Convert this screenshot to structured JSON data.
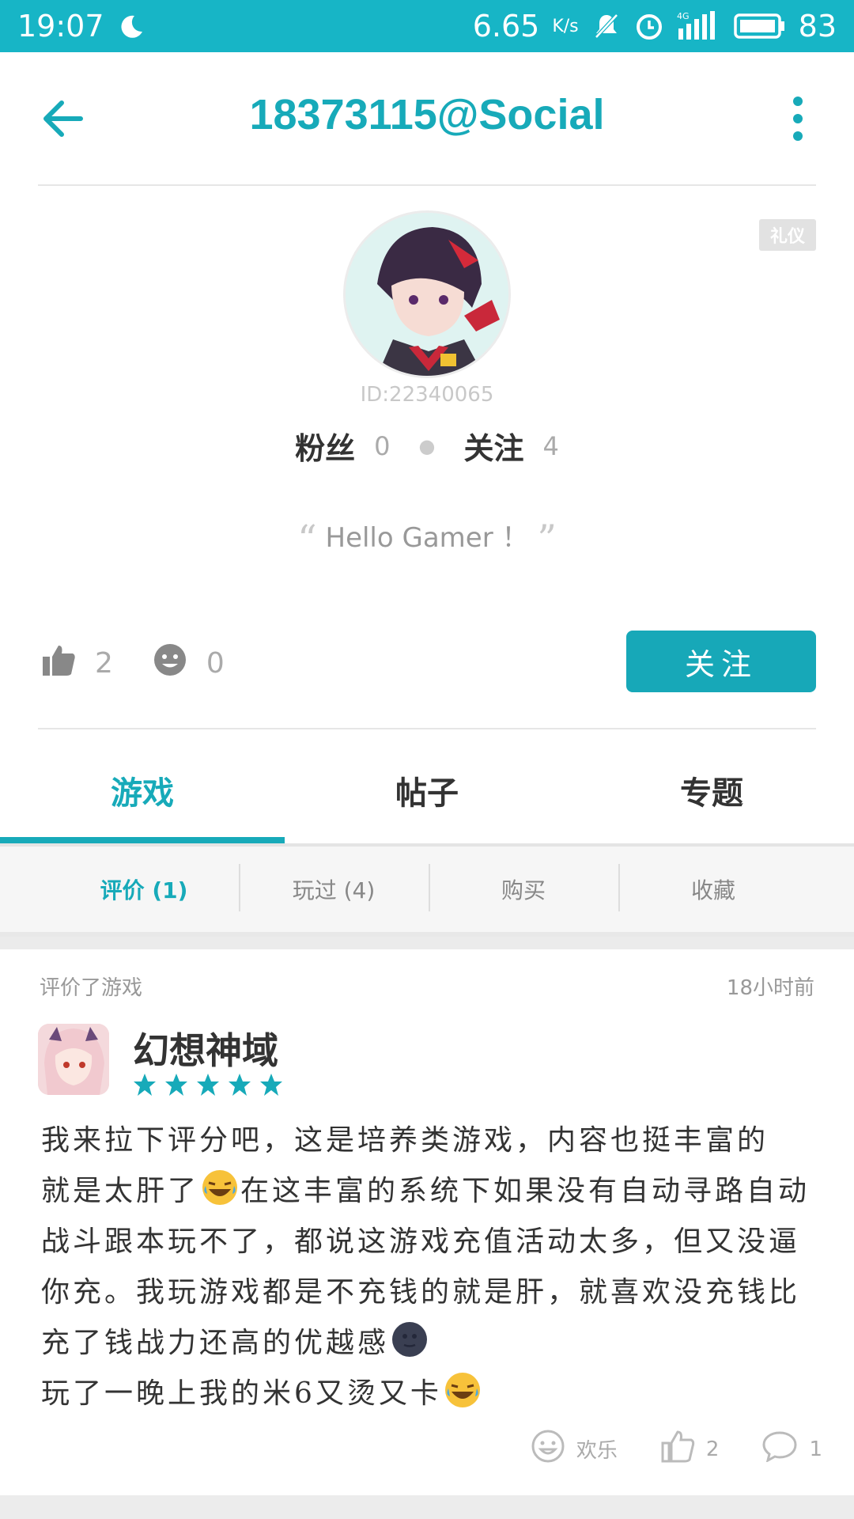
{
  "status_bar": {
    "time": "19:07",
    "net_speed": "6.65",
    "net_unit": "K/s",
    "network": "4G",
    "battery": "83"
  },
  "header": {
    "title": "18373115@Social"
  },
  "profile": {
    "etiquette_badge": "礼仪",
    "user_id": "ID:22340065",
    "fans_label": "粉丝",
    "fans_count": "0",
    "follow_label": "关注",
    "follow_count": "4",
    "bio": "Hello Gamer ！",
    "likes": "2",
    "smiles": "0",
    "follow_button": "关注"
  },
  "tabs": [
    {
      "label": "游戏",
      "active": true
    },
    {
      "label": "帖子",
      "active": false
    },
    {
      "label": "专题",
      "active": false
    }
  ],
  "subtabs": [
    {
      "label": "评价 (1)",
      "active": true
    },
    {
      "label": "玩过 (4)",
      "active": false
    },
    {
      "label": "购买",
      "active": false
    },
    {
      "label": "收藏",
      "active": false
    }
  ],
  "review_card": {
    "action_label": "评价了游戏",
    "time_ago": "18小时前",
    "game_name": "幻想神域",
    "stars": 5,
    "review_lines": [
      "我来拉下评分吧，这是培养类游戏，内容也挺丰富的",
      "就是太肝了",
      "在这丰富的系统下如果没有自动寻路自动战斗跟本玩不了，都说这游戏充值活动太多，但又没逼你充。我玩游戏都是不充钱的就是肝，就喜欢没充钱比充了钱战力还高的优越感",
      "玩了一晚上我的米6又烫又卡"
    ],
    "fun_label": "欢乐",
    "like_count": "2",
    "comment_count": "1"
  },
  "colors": {
    "accent": "#17aab9",
    "status_bar": "#17b5c6",
    "star": "#17aab9"
  }
}
